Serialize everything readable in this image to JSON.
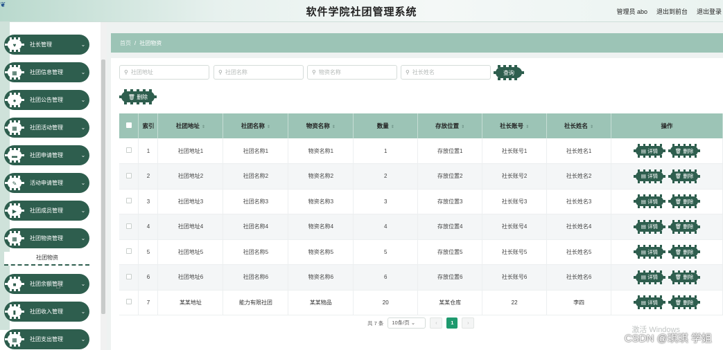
{
  "header": {
    "title": "软件学院社团管理系统",
    "user": "管理员 abo",
    "back_front": "退出到前台",
    "logout": "退出登录"
  },
  "sidebar": {
    "items": [
      {
        "label": "社长管理"
      },
      {
        "label": "社团信息管理"
      },
      {
        "label": "社团公告管理"
      },
      {
        "label": "社团活动管理"
      },
      {
        "label": "社团申请管理"
      },
      {
        "label": "活动申请管理"
      },
      {
        "label": "社团成员管理"
      },
      {
        "label": "社团物资管理"
      },
      {
        "label": "社团余额管理"
      },
      {
        "label": "社团收入管理"
      },
      {
        "label": "社团支出管理"
      }
    ],
    "submenu_label": "社团物资"
  },
  "breadcrumb": {
    "home": "首页",
    "sep": "/",
    "current": "社团物资"
  },
  "search": {
    "f1": "社团地址",
    "f2": "社团名称",
    "f3": "物资名称",
    "f4": "社长姓名",
    "query_button": "查询",
    "delete_button": "删除"
  },
  "table": {
    "headers": [
      "索引",
      "社团地址",
      "社团名称",
      "物资名称",
      "数量",
      "存放位置",
      "社长账号",
      "社长姓名",
      "操作"
    ],
    "rows": [
      [
        "1",
        "社团地址1",
        "社团名称1",
        "物资名称1",
        "1",
        "存放位置1",
        "社长账号1",
        "社长姓名1"
      ],
      [
        "2",
        "社团地址2",
        "社团名称2",
        "物资名称2",
        "2",
        "存放位置2",
        "社长账号2",
        "社长姓名2"
      ],
      [
        "3",
        "社团地址3",
        "社团名称3",
        "物资名称3",
        "3",
        "存放位置3",
        "社长账号3",
        "社长姓名3"
      ],
      [
        "4",
        "社团地址4",
        "社团名称4",
        "物资名称4",
        "4",
        "存放位置4",
        "社长账号4",
        "社长姓名4"
      ],
      [
        "5",
        "社团地址5",
        "社团名称5",
        "物资名称5",
        "5",
        "存放位置5",
        "社长账号5",
        "社长姓名5"
      ],
      [
        "6",
        "社团地址6",
        "社团名称6",
        "物资名称6",
        "6",
        "存放位置6",
        "社长账号6",
        "社长姓名6"
      ],
      [
        "7",
        "某某地址",
        "能力有限社团",
        "某某物品",
        "20",
        "某某仓库",
        "22",
        "李四"
      ]
    ],
    "detail_label": "详情",
    "delete_label": "删除"
  },
  "pager": {
    "total": "共 7 条",
    "size": "10条/页",
    "prev": "‹",
    "page": "1",
    "next": "›"
  },
  "overlay": {
    "watermark": "激活 Windows",
    "csdn": "CSDN @琪琪 学姐"
  },
  "colors": {
    "primary": "#2e5e4e",
    "accent": "#9cc4b6",
    "pager_active": "#1e9a6e"
  }
}
